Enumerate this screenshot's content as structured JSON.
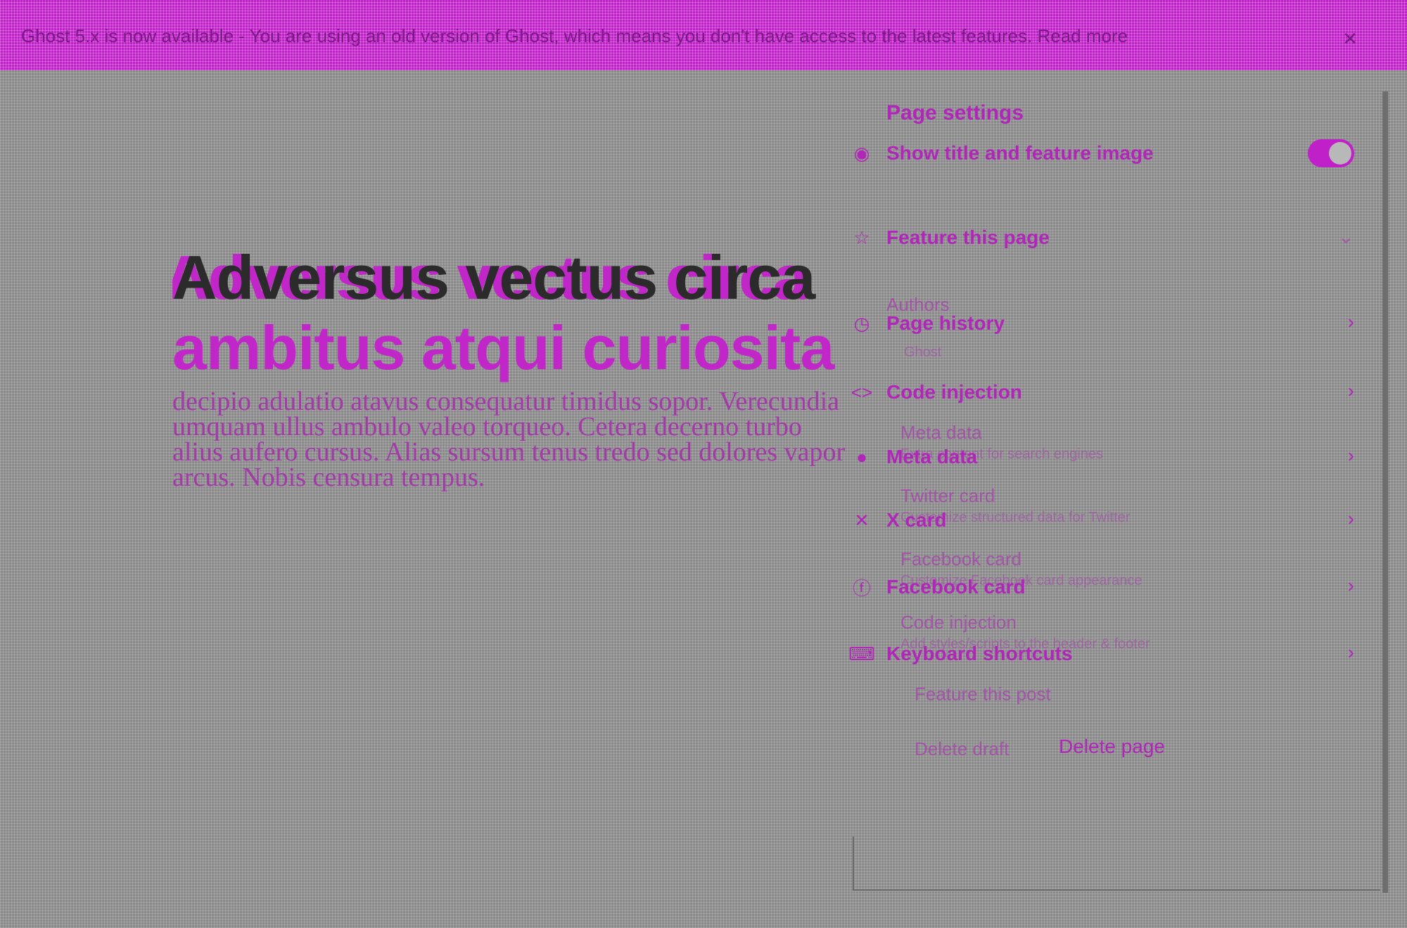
{
  "banner": {
    "text": "Ghost 5.x is now available - You are using an old version of Ghost, which means you don't have access to the latest features. Read more",
    "close_icon": "close-icon",
    "color": "#c020c8"
  },
  "editor": {
    "title_line_1": "Adversus vectus circa",
    "title_line_2": "ambitus atqui curiosita",
    "excerpt": "decipio adulatio atavus consequatur timidus sopor. Verecundia umquam ullus ambulo valeo torqueo. Cetera decerno turbo alius aufero cursus. Alias sursum tenus tredo sed dolores vapor arcus. Nobis censura tempus."
  },
  "panel": {
    "title": "Page settings",
    "show_title": {
      "label": "Show title and feature image",
      "icon": "eye-icon",
      "enabled": true
    },
    "feature_page": {
      "label": "Feature this page",
      "icon": "star-icon"
    },
    "history": {
      "label": "Page history",
      "icon": "history-icon",
      "ghost": "Authors",
      "ghost_sub": "Ghost"
    },
    "code_injection": {
      "label": "Code injection",
      "icon": "code-icon",
      "ghost": "Meta data",
      "ghost_sub": "Extra content for search engines"
    },
    "meta_data": {
      "label": "Meta data",
      "icon": "globe-icon",
      "ghost": "Twitter card",
      "ghost_sub": "Customize structured data for Twitter"
    },
    "x_card": {
      "label": "X card",
      "icon": "x-icon",
      "ghost": "Facebook card",
      "ghost_sub": "Customize Facebook card appearance"
    },
    "facebook_card": {
      "label": "Facebook card",
      "icon": "facebook-icon",
      "ghost": "Code injection",
      "ghost_sub": "Add styles/scripts to the header & footer"
    },
    "shortcuts": {
      "label": "Keyboard shortcuts",
      "icon": "keyboard-icon",
      "ghost": "Feature this post"
    },
    "delete_ghost": "Delete draft",
    "delete_label": "Delete page"
  }
}
